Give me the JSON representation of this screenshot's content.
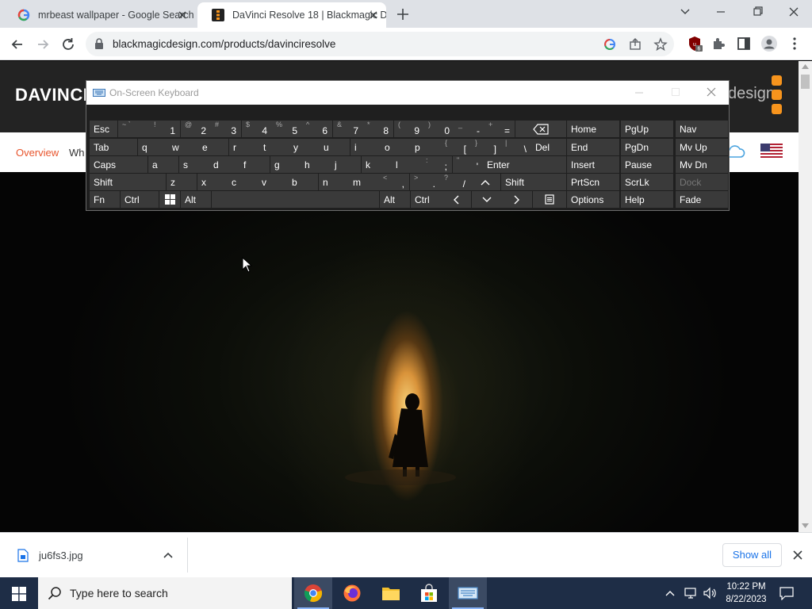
{
  "browser": {
    "tabs": [
      {
        "title": "mrbeast wallpaper - Google Search",
        "active": false
      },
      {
        "title": "DaVinci Resolve 18 | Blackmagic Design",
        "active": true
      }
    ],
    "url": "blackmagicdesign.com/products/davinciresolve",
    "extension_badge": "6"
  },
  "site": {
    "logo": "DAVINCI",
    "brand_tail": "design",
    "nav": {
      "overview": "Overview",
      "whats_new": "Wh"
    }
  },
  "osk": {
    "title": "On-Screen Keyboard",
    "rows": [
      [
        {
          "main": "Esc"
        },
        {
          "sub": "~ `"
        },
        {
          "sub": "!",
          "prim": "1"
        },
        {
          "sub": "@",
          "prim": "2"
        },
        {
          "sub": "#",
          "prim": "3"
        },
        {
          "sub": "$",
          "prim": "4"
        },
        {
          "sub": "%",
          "prim": "5"
        },
        {
          "sub": "^",
          "prim": "6"
        },
        {
          "sub": "&",
          "prim": "7"
        },
        {
          "sub": "*",
          "prim": "8"
        },
        {
          "sub": "(",
          "prim": "9"
        },
        {
          "sub": ")",
          "prim": "0"
        },
        {
          "sub": "_",
          "prim": "-"
        },
        {
          "sub": "+",
          "prim": "="
        },
        {
          "icon": "backspace"
        }
      ],
      [
        {
          "main": "Tab"
        },
        {
          "main": "q"
        },
        {
          "main": "w"
        },
        {
          "main": "e"
        },
        {
          "main": "r"
        },
        {
          "main": "t"
        },
        {
          "main": "y"
        },
        {
          "main": "u"
        },
        {
          "main": "i"
        },
        {
          "main": "o"
        },
        {
          "main": "p"
        },
        {
          "sub": "{",
          "prim": "["
        },
        {
          "sub": "}",
          "prim": "]"
        },
        {
          "sub": "|",
          "prim": "\\"
        },
        {
          "main": "Del"
        }
      ],
      [
        {
          "main": "Caps"
        },
        {
          "main": "a"
        },
        {
          "main": "s"
        },
        {
          "main": "d"
        },
        {
          "main": "f"
        },
        {
          "main": "g"
        },
        {
          "main": "h"
        },
        {
          "main": "j"
        },
        {
          "main": "k"
        },
        {
          "main": "l"
        },
        {
          "sub": ":",
          "prim": ";"
        },
        {
          "sub": "\"",
          "prim": "'"
        },
        {
          "main": "Enter"
        }
      ],
      [
        {
          "main": "Shift"
        },
        {
          "main": "z"
        },
        {
          "main": "x"
        },
        {
          "main": "c"
        },
        {
          "main": "v"
        },
        {
          "main": "b"
        },
        {
          "main": "n"
        },
        {
          "main": "m"
        },
        {
          "sub": "<",
          "prim": ","
        },
        {
          "sub": ">",
          "prim": "."
        },
        {
          "sub": "?",
          "prim": "/"
        },
        {
          "icon": "up"
        },
        {
          "main": "Shift"
        }
      ],
      [
        {
          "main": "Fn"
        },
        {
          "main": "Ctrl"
        },
        {
          "icon": "windows"
        },
        {
          "main": "Alt"
        },
        {
          "main": ""
        },
        {
          "main": "Alt"
        },
        {
          "main": "Ctrl"
        },
        {
          "icon": "left"
        },
        {
          "icon": "down"
        },
        {
          "icon": "right"
        },
        {
          "icon": "menu"
        }
      ]
    ],
    "nav_keys": [
      [
        "Home",
        "PgUp",
        "Nav"
      ],
      [
        "End",
        "PgDn",
        "Mv Up"
      ],
      [
        "Insert",
        "Pause",
        "Mv Dn"
      ],
      [
        "PrtScn",
        "ScrLk",
        "Dock"
      ],
      [
        "Options",
        "Help",
        "Fade"
      ]
    ]
  },
  "download": {
    "filename": "ju6fs3.jpg",
    "show_all": "Show all"
  },
  "taskbar": {
    "search_placeholder": "Type here to search",
    "time": "10:22 PM",
    "date": "8/22/2023"
  },
  "colors": {
    "accent_orange": "#f7941d",
    "link_blue": "#1a73e8",
    "taskbar": "#1e2d46"
  }
}
